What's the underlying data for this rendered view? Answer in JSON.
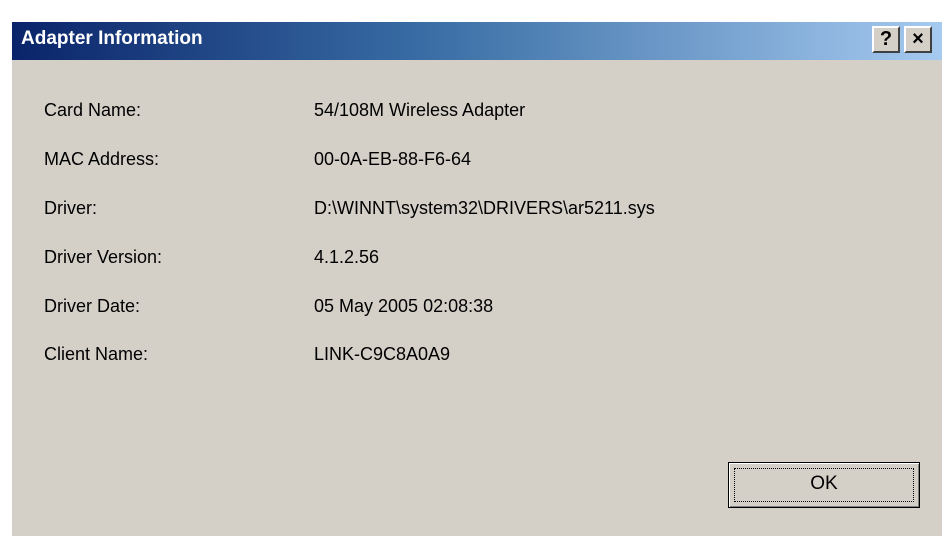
{
  "window": {
    "title": "Adapter Information",
    "help_label": "?",
    "close_label": "×"
  },
  "info": {
    "rows": [
      {
        "label": "Card Name:",
        "value": "54/108M Wireless Adapter"
      },
      {
        "label": "MAC Address:",
        "value": "00-0A-EB-88-F6-64"
      },
      {
        "label": "Driver:",
        "value": "D:\\WINNT\\system32\\DRIVERS\\ar5211.sys"
      },
      {
        "label": "Driver Version:",
        "value": "4.1.2.56"
      },
      {
        "label": "Driver Date:",
        "value": "05 May 2005 02:08:38"
      },
      {
        "label": "Client Name:",
        "value": "LINK-C9C8A0A9"
      }
    ]
  },
  "buttons": {
    "ok_label": "OK"
  },
  "colors": {
    "title_start": "#0a246a",
    "title_end": "#a6caf0",
    "dialog_bg": "#d4d0c8"
  }
}
